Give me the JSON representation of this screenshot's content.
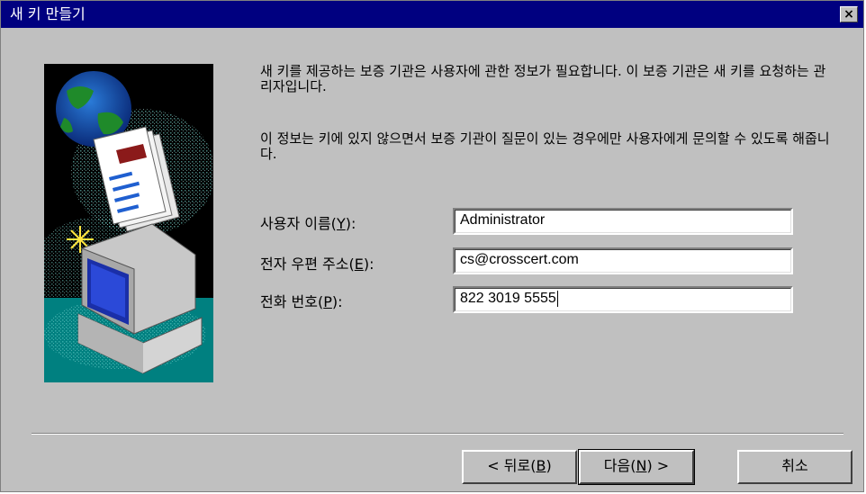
{
  "window": {
    "title": "새 키 만들기",
    "close_label": "×"
  },
  "intro": {
    "paragraph1": "새 키를 제공하는 보증 기관은 사용자에 관한 정보가 필요합니다. 이 보증 기관은 새 키를 요청하는 관리자입니다.",
    "paragraph2": "이 정보는 키에 있지 않으면서 보증 기관이 질문이 있는 경우에만 사용자에게 문의할 수 있도록 해줍니다."
  },
  "form": {
    "username": {
      "label_before": "사용자 이름(",
      "label_key": "Y",
      "label_after": "):",
      "value": "Administrator"
    },
    "email": {
      "label_before": "전자 우편 주소(",
      "label_key": "E",
      "label_after": "):",
      "value": "cs@crosscert.com"
    },
    "phone": {
      "label_before": "전화 번호(",
      "label_key": "P",
      "label_after": "):",
      "value": "822 3019 5555"
    }
  },
  "buttons": {
    "back": {
      "before": "< 뒤로(",
      "key": "B",
      "after": ")"
    },
    "next": {
      "before": "다음(",
      "key": "N",
      "after": ") >"
    },
    "cancel": {
      "label": "취소"
    }
  },
  "colors": {
    "titlebar": "#000080",
    "dialog_bg": "#c0c0c0",
    "image_bg": "#008080"
  }
}
